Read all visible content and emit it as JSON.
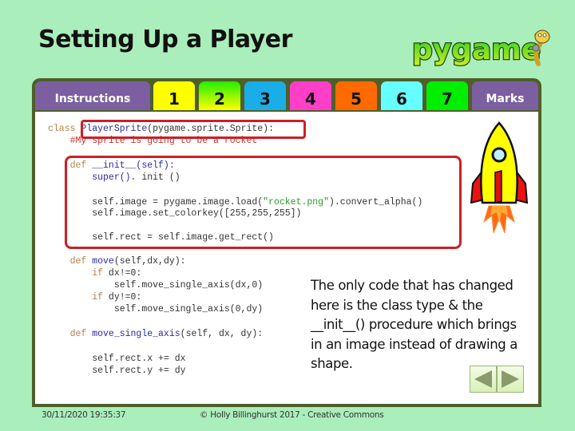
{
  "slide": {
    "title": "Setting Up a Player",
    "logo_text": "pygame"
  },
  "tabs": [
    {
      "label": "Instructions",
      "color": "#7b5fa0"
    },
    {
      "label": "1",
      "color": "#ffff00"
    },
    {
      "label": "2",
      "color": "gradient-green-yellow"
    },
    {
      "label": "3",
      "color": "#1aaee8"
    },
    {
      "label": "4",
      "color": "#ff3fc8"
    },
    {
      "label": "5",
      "color": "#ff6a00"
    },
    {
      "label": "6",
      "color": "#66ffff"
    },
    {
      "label": "7",
      "color": "#00ee00"
    },
    {
      "label": "Marks",
      "color": "#7b5fa0"
    }
  ],
  "code": {
    "line1_kw": "class ",
    "line1_name": "PlayerSprite",
    "line1_rest": "(pygame.sprite.Sprite):",
    "line2": "    #My sprite is going to be a rocket",
    "line3_kw": "    def ",
    "line3_rest": "__init__(self):",
    "line4_fn": "        super()",
    "line4_rest": ". init ()",
    "line5_a": "        self.image = pygame.image.load(",
    "line5_str": "\"rocket.png\"",
    "line5_b": ").convert_alpha()",
    "line6": "        self.image.set_colorkey([255,255,255])",
    "line7": "        self.rect = self.image.get_rect()",
    "line8_kw": "    def ",
    "line8_fn": "move",
    "line8_rest": "(self,dx,dy):",
    "line9_kw": "        if ",
    "line9_rest": "dx!=0:",
    "line10": "            self.move_single_axis(dx,0)",
    "line11_kw": "        if ",
    "line11_rest": "dy!=0:",
    "line12": "            self.move_single_axis(0,dy)",
    "line13_kw": "    def ",
    "line13_fn": "move_single_axis",
    "line13_rest": "(self, dx, dy):",
    "line14": "        self.rect.x += dx",
    "line15": "        self.rect.y += dy"
  },
  "explanation": "The only code that has changed here is the class type & the __init__() procedure which brings in an image instead of drawing a shape.",
  "nav": {
    "prev_icon": "triangle-left-icon",
    "next_icon": "triangle-right-icon"
  },
  "footer": {
    "datetime": "30/11/2020 19:35:37",
    "copyright": "© Holly Billinghurst 2017 - Creative Commons"
  }
}
